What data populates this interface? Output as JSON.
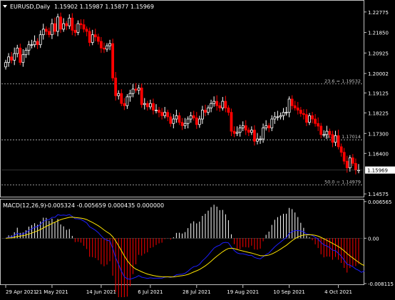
{
  "header": {
    "symbol_timeframe": "EURUSD,Daily",
    "ohlc": "1.15902 1.15987 1.15877 1.15969"
  },
  "macd_header": {
    "label": "MACD(12,26,9)",
    "values": "-0.005324 -0.005659 0.000435 0.000000"
  },
  "current_price_label": "1.15969",
  "colors": {
    "background": "#000000",
    "bull_candle": "#ffffff",
    "bear_candle": "#ff0000",
    "frame": "#c0c0c0",
    "macd_main": "#1e1eff",
    "macd_signal": "#ffe600",
    "hist_up": "#ffffff",
    "hist_down": "#ff0000",
    "fib_lines": "#c0c0c0"
  },
  "fib_levels": [
    {
      "label": "23.6 = 1.19532",
      "price": 1.19532
    },
    {
      "label": "38.2 = 1.17014",
      "price": 1.17014
    },
    {
      "label": "50.0 = 1.14979",
      "price": 1.14979
    }
  ],
  "chart_data": [
    {
      "type": "candlestick",
      "title": "EURUSD,Daily",
      "y_ticks": [
        "1.22775",
        "1.21850",
        "1.20925",
        "1.20002",
        "1.19125",
        "1.18225",
        "1.17300",
        "1.16400",
        "1.15475",
        "1.14575"
      ],
      "y_tick_values": [
        1.22775,
        1.2185,
        1.20925,
        1.20002,
        1.19125,
        1.18225,
        1.173,
        1.164,
        1.15475,
        1.14575
      ],
      "ylim": [
        1.1445,
        1.2325
      ],
      "x_ticks": [
        "29 Apr 2021",
        "21 May 2021",
        "14 Jun 2021",
        "6 Jul 2021",
        "28 Jul 2021",
        "19 Aug 2021",
        "10 Sep 2021",
        "4 Oct 2021"
      ],
      "x_tick_bar_index": [
        0,
        16,
        33,
        50,
        66,
        82,
        98,
        115
      ],
      "bar_count": 123,
      "close": [
        1.205,
        1.2075,
        1.206,
        1.209,
        1.2115,
        1.205,
        1.2085,
        1.2105,
        1.213,
        1.213,
        1.2145,
        1.213,
        1.2175,
        1.22,
        1.219,
        1.2175,
        1.2225,
        1.219,
        1.2255,
        1.22,
        1.2225,
        1.2215,
        1.225,
        1.2195,
        1.2185,
        1.2225,
        1.222,
        1.22,
        1.219,
        1.214,
        1.2175,
        1.2165,
        1.2145,
        1.2115,
        1.211,
        1.2125,
        1.2135,
        1.198,
        1.19,
        1.191,
        1.1865,
        1.1855,
        1.1895,
        1.191,
        1.193,
        1.1925,
        1.1935,
        1.186,
        1.1865,
        1.185,
        1.1865,
        1.1835,
        1.1835,
        1.1825,
        1.181,
        1.1825,
        1.1805,
        1.1775,
        1.1795,
        1.181,
        1.178,
        1.1765,
        1.1775,
        1.1795,
        1.181,
        1.18,
        1.177,
        1.1795,
        1.1835,
        1.1825,
        1.1845,
        1.1865,
        1.1875,
        1.1855,
        1.1845,
        1.1875,
        1.1845,
        1.1825,
        1.174,
        1.173,
        1.1735,
        1.1755,
        1.1765,
        1.1745,
        1.1735,
        1.1745,
        1.1695,
        1.1705,
        1.1705,
        1.1755,
        1.1765,
        1.1755,
        1.1795,
        1.1805,
        1.1805,
        1.181,
        1.1825,
        1.1825,
        1.1885,
        1.1855,
        1.1845,
        1.1835,
        1.182,
        1.1815,
        1.178,
        1.181,
        1.1795,
        1.1775,
        1.1763,
        1.1725,
        1.1725,
        1.174,
        1.1725,
        1.169,
        1.172,
        1.167,
        1.1645,
        1.1605,
        1.1575,
        1.162,
        1.1595,
        1.1565,
        1.1565,
        1.1535,
        1.1597
      ],
      "volatility_note_omitted": true
    },
    {
      "type": "macd",
      "title": "MACD(12,26,9)",
      "y_ticks": [
        "0.006565",
        "0.00",
        "-0.008115"
      ],
      "ylim": [
        -0.00825,
        0.0068
      ],
      "series": [
        {
          "name": "MACD main",
          "kind": "histogram"
        },
        {
          "name": "Signal",
          "kind": "line"
        }
      ]
    }
  ]
}
